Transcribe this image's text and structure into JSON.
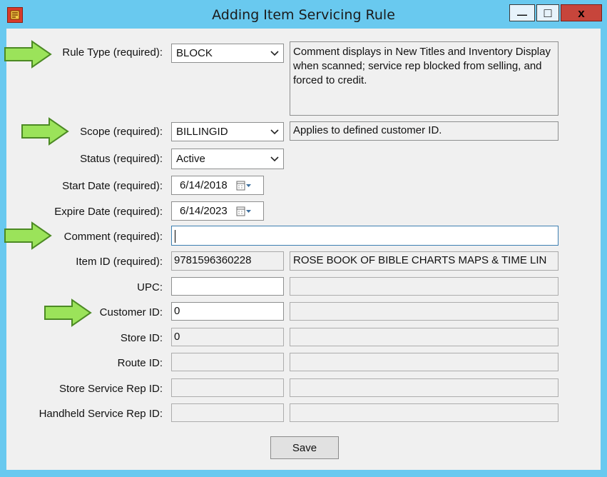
{
  "window": {
    "title": "Adding Item Servicing Rule",
    "minimize_glyph": "—",
    "maximize_glyph": "□",
    "close_glyph": "x"
  },
  "form": {
    "rule_type": {
      "label": "Rule Type (required):",
      "value": "BLOCK",
      "description": "Comment displays in New Titles and Inventory Display when scanned; service rep blocked from selling, and forced to credit."
    },
    "scope": {
      "label": "Scope (required):",
      "value": "BILLINGID",
      "description": "Applies to defined customer ID."
    },
    "status": {
      "label": "Status (required):",
      "value": "Active"
    },
    "start_date": {
      "label": "Start Date (required):",
      "value": "6/14/2018"
    },
    "expire_date": {
      "label": "Expire Date (required):",
      "value": "6/14/2023"
    },
    "comment": {
      "label": "Comment (required):",
      "value": ""
    },
    "item_id": {
      "label": "Item ID (required):",
      "value": "9781596360228",
      "description": "ROSE BOOK OF BIBLE CHARTS MAPS & TIME LIN"
    },
    "upc": {
      "label": "UPC:",
      "value": "",
      "description": ""
    },
    "customer_id": {
      "label": "Customer ID:",
      "value": "0",
      "description": ""
    },
    "store_id": {
      "label": "Store ID:",
      "value": "0",
      "description": ""
    },
    "route_id": {
      "label": "Route ID:",
      "value": "",
      "description": ""
    },
    "store_service_rep_id": {
      "label": "Store Service Rep ID:",
      "value": "",
      "description": ""
    },
    "handheld_service_rep_id": {
      "label": "Handheld Service Rep ID:",
      "value": "",
      "description": ""
    },
    "save_label": "Save"
  },
  "colors": {
    "frame": "#69c9ef",
    "client": "#f0f0f0",
    "arrow_fill": "#9be35a",
    "arrow_stroke": "#4c8a24",
    "close_button": "#c7453b"
  },
  "icons": {
    "app": "app-icon",
    "dropdown": "chevron-down-icon",
    "calendar": "calendar-icon",
    "highlight": "green-arrow-icon"
  }
}
